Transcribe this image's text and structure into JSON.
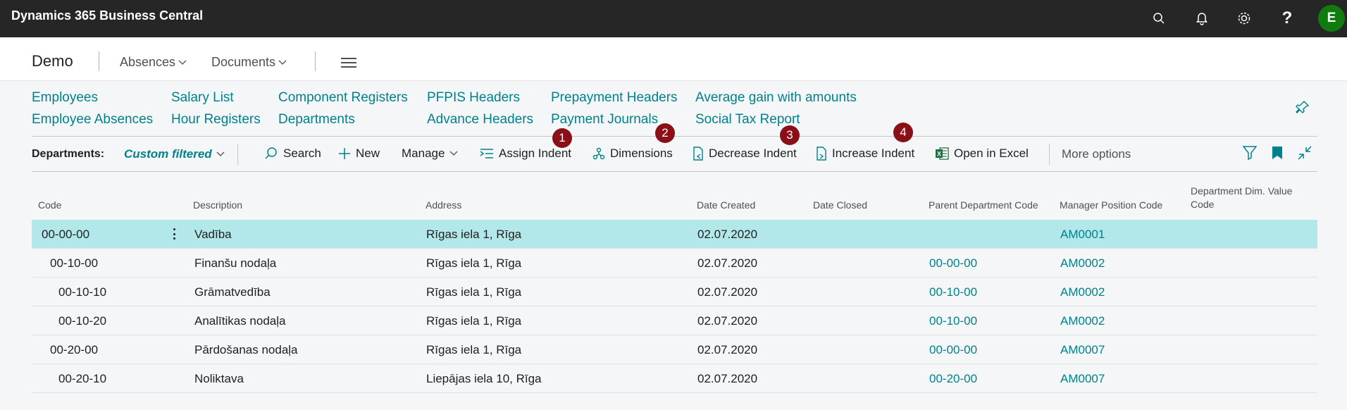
{
  "app": {
    "title": "Dynamics 365 Business Central",
    "user_initial": "E"
  },
  "icons": {
    "search": "search-icon",
    "notifications": "bell-icon",
    "settings": "gear-icon",
    "help": "help-icon",
    "menu": "hamburger-icon",
    "pin": "pin-icon",
    "filter": "filter-icon",
    "bookmark": "bookmark-icon",
    "collapse": "collapse-icon"
  },
  "colors": {
    "topbar": "#262626",
    "accent": "#00818c",
    "avatar": "#107c10",
    "badge": "#8b0f16",
    "selected_row": "#b3e8ea"
  },
  "nav": {
    "company": "Demo",
    "menus": [
      "Absences",
      "Documents"
    ]
  },
  "links": [
    "Employees",
    "Salary List",
    "Component Registers",
    "PFPIS Headers",
    "Prepayment Headers",
    "Average gain with amounts",
    "Employee Absences",
    "Hour Registers",
    "Departments",
    "Advance Headers",
    "Payment Journals",
    "Social Tax Report"
  ],
  "actionbar": {
    "list_title": "Departments:",
    "view": "Custom filtered",
    "actions": [
      "Search",
      "New",
      "Manage",
      "Assign Indent",
      "Dimensions",
      "Decrease Indent",
      "Increase Indent",
      "Open in Excel"
    ],
    "more": "More options"
  },
  "badges": [
    "1",
    "2",
    "3",
    "4"
  ],
  "table": {
    "columns": [
      "Code",
      "Description",
      "Address",
      "Date Created",
      "Date Closed",
      "Parent Department Code",
      "Manager Position Code",
      "Department Dim. Value Code"
    ],
    "rows": [
      {
        "code": "00-00-00",
        "description": "Vadība",
        "address": "Rīgas iela 1, Rīga",
        "date_created": "02.07.2020",
        "date_closed": "",
        "parent": "",
        "manager": "AM0001"
      },
      {
        "code": "00-10-00",
        "description": "Finanšu nodaļa",
        "address": "Rīgas iela 1, Rīga",
        "date_created": "02.07.2020",
        "date_closed": "",
        "parent": "00-00-00",
        "manager": "AM0002"
      },
      {
        "code": "00-10-10",
        "description": "Grāmatvedība",
        "address": "Rīgas iela 1, Rīga",
        "date_created": "02.07.2020",
        "date_closed": "",
        "parent": "00-10-00",
        "manager": "AM0002"
      },
      {
        "code": "00-10-20",
        "description": "Analītikas nodaļa",
        "address": "Rīgas iela 1, Rīga",
        "date_created": "02.07.2020",
        "date_closed": "",
        "parent": "00-10-00",
        "manager": "AM0002"
      },
      {
        "code": "00-20-00",
        "description": "Pārdošanas nodaļa",
        "address": "Rīgas iela 1, Rīga",
        "date_created": "02.07.2020",
        "date_closed": "",
        "parent": "00-00-00",
        "manager": "AM0007"
      },
      {
        "code": "00-20-10",
        "description": "Noliktava",
        "address": "Liepājas iela 10, Rīga",
        "date_created": "02.07.2020",
        "date_closed": "",
        "parent": "00-20-00",
        "manager": "AM0007"
      }
    ]
  }
}
